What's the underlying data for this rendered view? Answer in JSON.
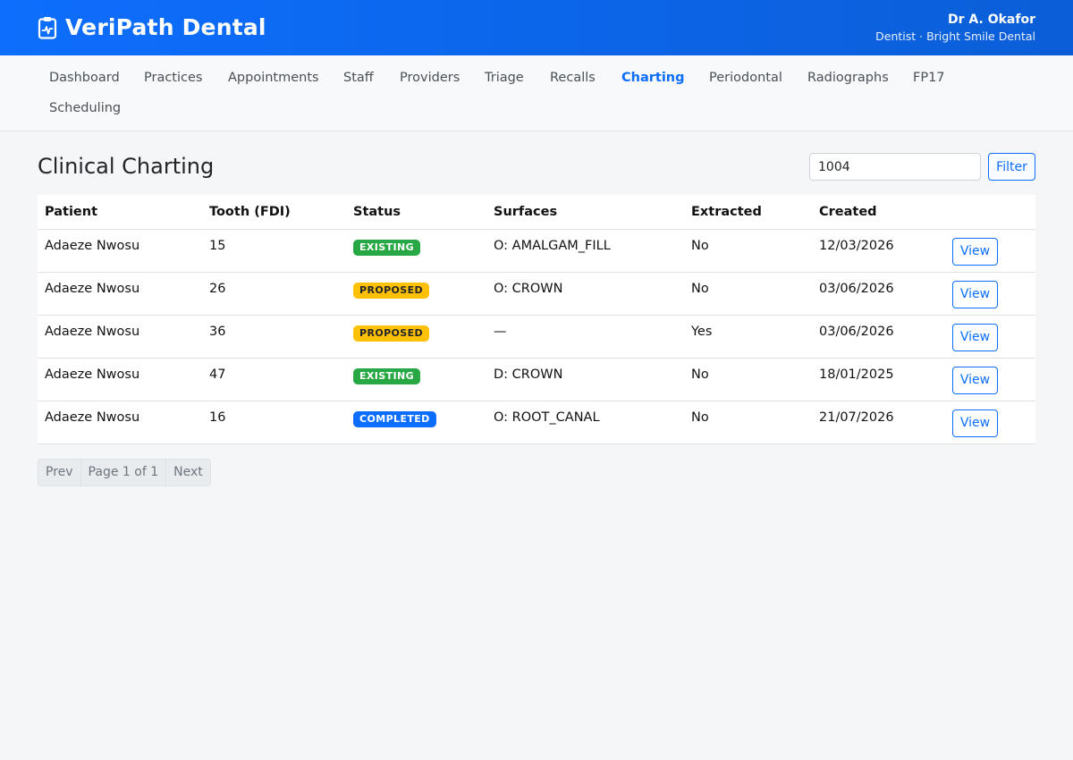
{
  "header": {
    "brand": "VeriPath Dental",
    "brand_icon": "clipboard-pulse-icon",
    "user_name": "Dr A. Okafor",
    "user_role": "Dentist · Bright Smile Dental"
  },
  "nav": {
    "items": [
      {
        "label": "Dashboard",
        "active": false
      },
      {
        "label": "Practices",
        "active": false
      },
      {
        "label": "Appointments",
        "active": false
      },
      {
        "label": "Staff",
        "active": false
      },
      {
        "label": "Providers",
        "active": false
      },
      {
        "label": "Triage",
        "active": false
      },
      {
        "label": "Recalls",
        "active": false
      },
      {
        "label": "Charting",
        "active": true
      },
      {
        "label": "Periodontal",
        "active": false
      },
      {
        "label": "Radiographs",
        "active": false
      },
      {
        "label": "FP17",
        "active": false
      },
      {
        "label": "Scheduling",
        "active": false
      }
    ]
  },
  "main": {
    "title": "Clinical Charting",
    "filter_value": "1004",
    "filter_button": "Filter"
  },
  "table": {
    "headers": [
      "Patient",
      "Tooth (FDI)",
      "Status",
      "Surfaces",
      "Extracted",
      "Created",
      ""
    ],
    "rows": [
      {
        "patient": "Adaeze Nwosu",
        "tooth": "15",
        "status": "EXISTING",
        "surfaces": "O: AMALGAM_FILL",
        "extracted": "No",
        "created": "12/03/2026",
        "action": "View"
      },
      {
        "patient": "Adaeze Nwosu",
        "tooth": "26",
        "status": "PROPOSED",
        "surfaces": "O: CROWN",
        "extracted": "No",
        "created": "03/06/2026",
        "action": "View"
      },
      {
        "patient": "Adaeze Nwosu",
        "tooth": "36",
        "status": "PROPOSED",
        "surfaces": "—",
        "extracted": "Yes",
        "created": "03/06/2026",
        "action": "View"
      },
      {
        "patient": "Adaeze Nwosu",
        "tooth": "47",
        "status": "EXISTING",
        "surfaces": "D: CROWN",
        "extracted": "No",
        "created": "18/01/2025",
        "action": "View"
      },
      {
        "patient": "Adaeze Nwosu",
        "tooth": "16",
        "status": "COMPLETED",
        "surfaces": "O: ROOT_CANAL",
        "extracted": "No",
        "created": "21/07/2026",
        "action": "View"
      }
    ]
  },
  "pagination": {
    "prev": "Prev",
    "page": "Page 1 of 1",
    "next": "Next"
  },
  "colors": {
    "primary": "#0d6efd",
    "existing": "#28a745",
    "proposed": "#ffc107",
    "completed": "#0d6efd"
  }
}
